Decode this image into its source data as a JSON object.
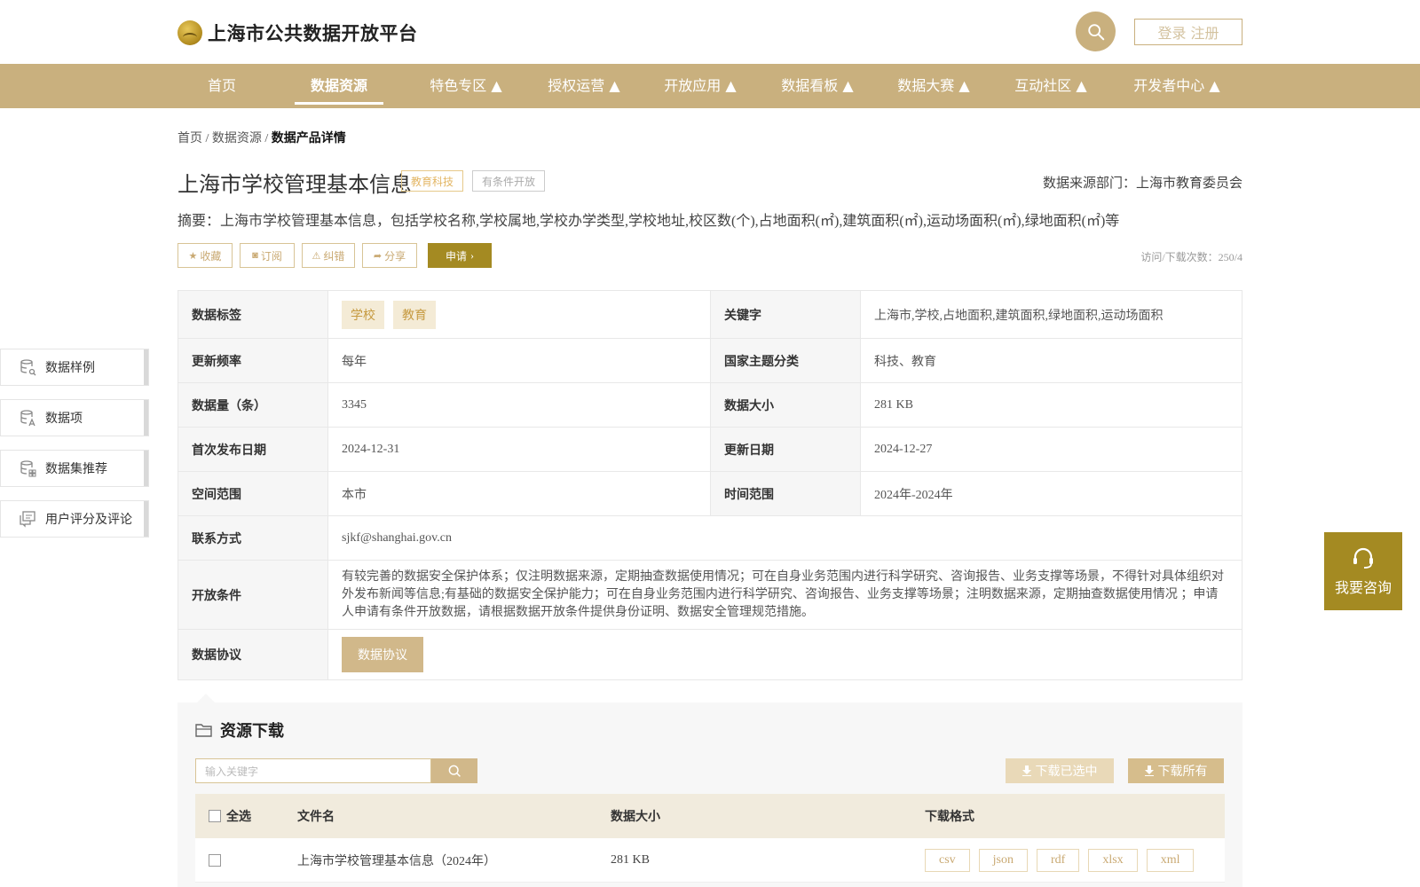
{
  "header": {
    "site_title": "上海市公共数据开放平台",
    "login_label": "登录 注册"
  },
  "nav": {
    "items": [
      {
        "label": "首页"
      },
      {
        "label": "数据资源"
      },
      {
        "label": "特色专区 ▲"
      },
      {
        "label": "授权运营 ▲"
      },
      {
        "label": "开放应用 ▲"
      },
      {
        "label": "数据看板 ▲"
      },
      {
        "label": "数据大赛 ▲"
      },
      {
        "label": "互动社区 ▲"
      },
      {
        "label": "开发者中心 ▲"
      }
    ],
    "active_index": 1
  },
  "breadcrumb": {
    "items": [
      "首页",
      "数据资源"
    ],
    "separator": "/",
    "current": "数据产品详情"
  },
  "dataset": {
    "title": "上海市学校管理基本信息",
    "category_tag": "教育科技",
    "open_tag": "有条件开放",
    "source": "数据来源部门：上海市教育委员会",
    "summary": "摘要：上海市学校管理基本信息，包括学校名称,学校属地,学校办学类型,学校地址,校区数(个),占地面积(㎡),建筑面积(㎡),运动场面积(㎡),绿地面积(㎡)等",
    "visits": "访问/下载次数：250/4"
  },
  "actions": {
    "favorite": "收藏",
    "subscribe": "订阅",
    "report": "纠错",
    "share": "分享",
    "apply": "申请"
  },
  "info": {
    "tags_label": "数据标签",
    "tags": [
      "学校",
      "教育"
    ],
    "keywords_label": "关键字",
    "keywords": "上海市,学校,占地面积,建筑面积,绿地面积,运动场面积",
    "freq_label": "更新频率",
    "freq": "每年",
    "theme_label": "国家主题分类",
    "theme": "科技、教育",
    "count_label": "数据量（条）",
    "count": "3345",
    "size_label": "数据大小",
    "size": "281 KB",
    "first_pub_label": "首次发布日期",
    "first_pub": "2024-12-31",
    "updated_label": "更新日期",
    "updated": "2024-12-27",
    "space_label": "空间范围",
    "space": "本市",
    "time_label": "时间范围",
    "time": "2024年-2024年",
    "contact_label": "联系方式",
    "contact": "sjkf@shanghai.gov.cn",
    "conditions_label": "开放条件",
    "conditions": "有较完善的数据安全保护体系；仅注明数据来源，定期抽查数据使用情况；可在自身业务范围内进行科学研究、咨询报告、业务支撑等场景，不得针对具体组织对外发布新闻等信息;有基础的数据安全保护能力；可在自身业务范围内进行科学研究、咨询报告、业务支撑等场景；注明数据来源，定期抽查数据使用情况 ；申请人申请有条件开放数据，请根据数据开放条件提供身份证明、数据安全管理规范措施。",
    "protocol_label": "数据协议",
    "protocol_button": "数据协议"
  },
  "side_menu": {
    "items": [
      {
        "label": "数据样例",
        "icon": "database-search-icon"
      },
      {
        "label": "数据项",
        "icon": "database-text-icon"
      },
      {
        "label": "数据集推荐",
        "icon": "database-grid-icon"
      },
      {
        "label": "用户评分及评论",
        "icon": "comment-icon"
      }
    ]
  },
  "consult": {
    "label": "我要咨询"
  },
  "resources": {
    "title": "资源下载",
    "search_placeholder": "输入关键字",
    "download_selected": "下载已选中",
    "download_all": "下载所有",
    "columns": {
      "select_all": "全选",
      "filename": "文件名",
      "size": "数据大小",
      "formats": "下载格式"
    },
    "rows": [
      {
        "filename": "上海市学校管理基本信息（2024年）",
        "size": "281 KB",
        "formats": [
          "csv",
          "json",
          "rdf",
          "xlsx",
          "xml"
        ]
      }
    ]
  },
  "colors": {
    "brand": "#c9b07e",
    "accent": "#a48a22",
    "tag_orange": "#e3b664"
  }
}
